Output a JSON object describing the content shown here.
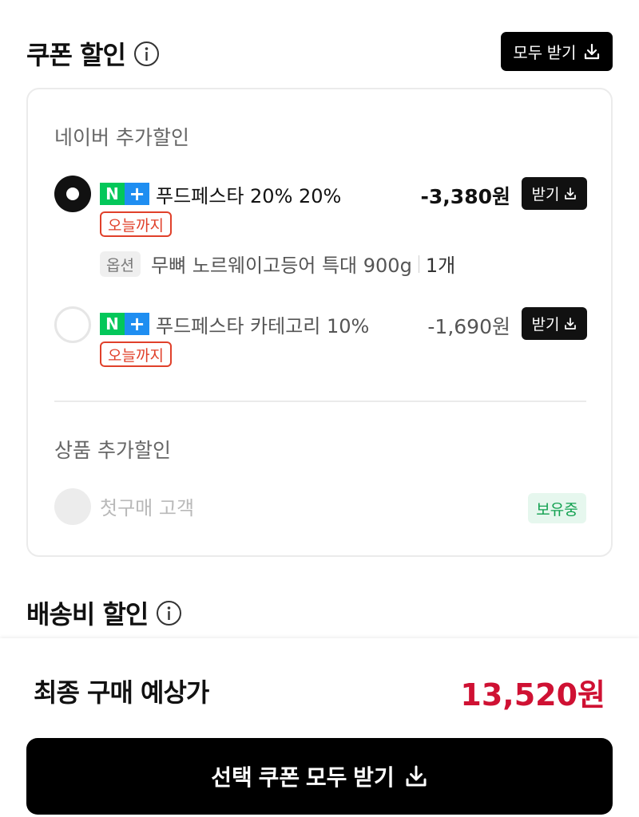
{
  "coupon_section": {
    "title": "쿠폰 할인",
    "info_icon": "info-circle-icon",
    "all_button_label": "모두 받기",
    "all_button_icon": "download-icon"
  },
  "naver_group": {
    "label": "네이버 추가할인",
    "coupons": [
      {
        "selected": true,
        "badge": "N+",
        "name": "푸드페스타 20% 20%",
        "deadline": "오늘까지",
        "amount": "-3,380원",
        "button_label": "받기",
        "option_tag": "옵션",
        "option_text": "무뼈 노르웨이고등어 특대 900g",
        "option_qty": "1개"
      },
      {
        "selected": false,
        "badge": "N+",
        "name": "푸드페스타 카테고리 10%",
        "deadline": "오늘까지",
        "amount": "-1,690원",
        "button_label": "받기"
      }
    ]
  },
  "product_group": {
    "label": "상품 추가할인",
    "coupons": [
      {
        "name": "첫구매 고객",
        "status": "보유중",
        "disabled": true
      }
    ]
  },
  "shipping_section": {
    "title": "배송비 할인",
    "info_icon": "info-circle-icon"
  },
  "summary": {
    "label": "최종 구매 예상가",
    "price": "13,520원",
    "cta_label": "선택 쿠폰 모두 받기",
    "cta_icon": "download-icon"
  },
  "colors": {
    "accent_price": "#cf1133",
    "deadline": "#e0402a",
    "held_badge_text": "#12a150",
    "naver_green": "#03c75a",
    "naver_blue": "#1f8ef1"
  }
}
